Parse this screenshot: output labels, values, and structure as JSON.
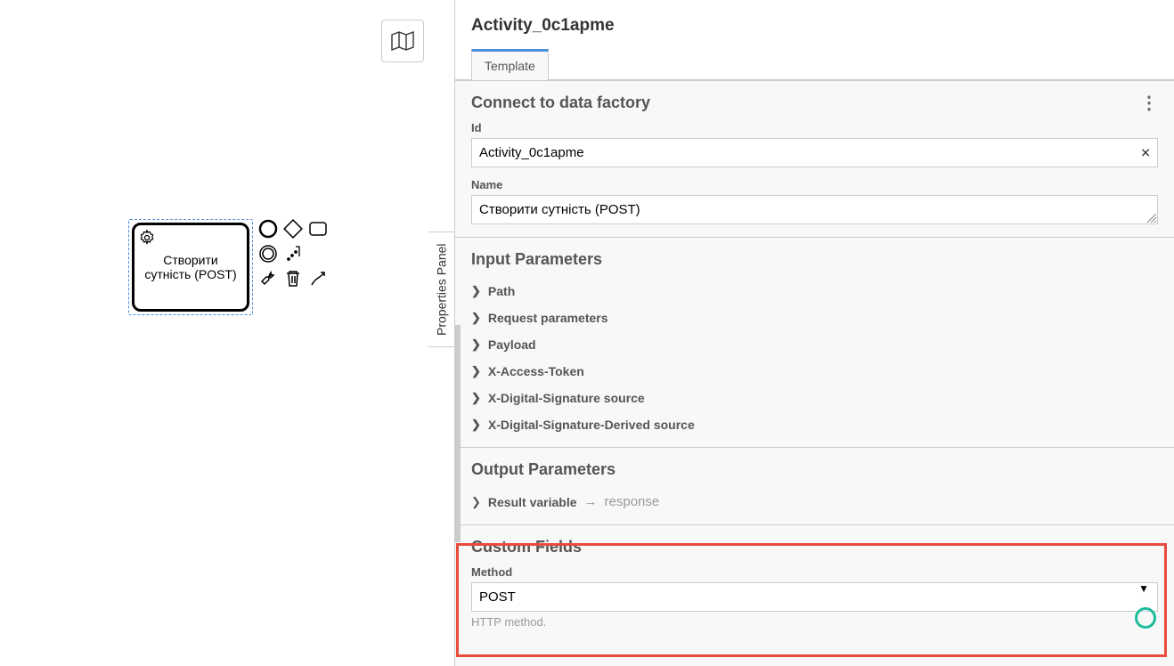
{
  "canvas": {
    "task_label": "Створити сутність (POST)"
  },
  "panel": {
    "side_tab_label": "Properties Panel",
    "title": "Activity_0c1apme",
    "tabs": [
      {
        "label": "Template"
      }
    ],
    "general": {
      "section_title": "Connect to data factory",
      "fields": {
        "id": {
          "label": "Id",
          "value": "Activity_0c1apme"
        },
        "name": {
          "label": "Name",
          "value": "Створити сутність (POST)"
        }
      }
    },
    "input": {
      "section_title": "Input Parameters",
      "items": [
        "Path",
        "Request parameters",
        "Payload",
        "X-Access-Token",
        "X-Digital-Signature source",
        "X-Digital-Signature-Derived source"
      ]
    },
    "output": {
      "section_title": "Output Parameters",
      "result": {
        "label": "Result variable",
        "value": "response"
      }
    },
    "custom": {
      "section_title": "Custom Fields",
      "method": {
        "label": "Method",
        "value": "POST",
        "help": "HTTP method."
      }
    }
  }
}
